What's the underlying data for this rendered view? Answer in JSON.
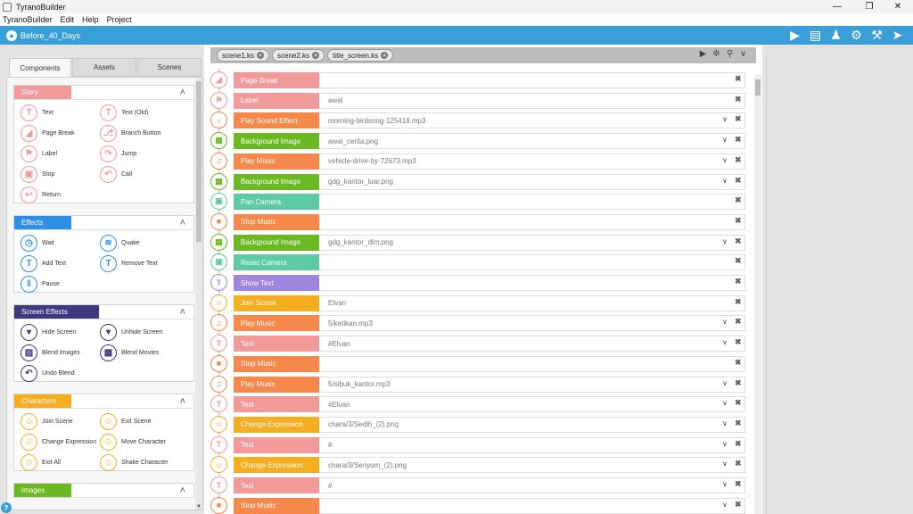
{
  "window": {
    "title": "TyranoBuilder"
  },
  "menu": [
    "TyranoBuilder",
    "Edit",
    "Help",
    "Project"
  ],
  "project": {
    "name": "Before_40_Days"
  },
  "left_tabs": [
    "Components",
    "Assets",
    "Scenes"
  ],
  "sections": [
    {
      "title": "Story",
      "color": "#f2999a",
      "items": [
        "Text",
        "Text (Old)",
        "Page Break",
        "Branch Button",
        "Label",
        "Jump",
        "Stop",
        "Call",
        "Return"
      ]
    },
    {
      "title": "Effects",
      "color": "#2f8fe6",
      "items": [
        "Wait",
        "Quake",
        "Add Text",
        "Remove Text",
        "Pause"
      ]
    },
    {
      "title": "Screen Effects",
      "color": "#3e3880",
      "items": [
        "Hide Screen",
        "Unhide Screen",
        "Blend Images",
        "Blend Movies",
        "Undo Blend"
      ]
    },
    {
      "title": "Characters",
      "color": "#f5ae1f",
      "items": [
        "Join Scene",
        "Exit Scene",
        "Change Expression",
        "Move Character",
        "Exit All",
        "Shake Character"
      ]
    },
    {
      "title": "Images",
      "color": "#6ab822",
      "items": []
    }
  ],
  "file_tabs": [
    "scene1.ks",
    "scene2.ks",
    "title_screen.ks"
  ],
  "script_rows": [
    {
      "label": "Page Break",
      "value": "",
      "color": "#f2999a",
      "icon": "page-break",
      "dropdown": false
    },
    {
      "label": "Label",
      "value": "awal",
      "color": "#f2999a",
      "icon": "label",
      "dropdown": false
    },
    {
      "label": "Play Sound Effect",
      "value": "morning-birdsong-125418.mp3",
      "color": "#f5884a",
      "icon": "sound",
      "dropdown": true
    },
    {
      "label": "Background Image",
      "value": "awal_cerita.png",
      "color": "#6ab822",
      "icon": "background",
      "dropdown": true
    },
    {
      "label": "Play Music",
      "value": "vehicle-drive-by-72673.mp3",
      "color": "#f5884a",
      "icon": "music",
      "dropdown": true
    },
    {
      "label": "Background Image",
      "value": "gdg_kantor_luar.png",
      "color": "#6ab822",
      "icon": "background",
      "dropdown": true
    },
    {
      "label": "Pan Camera",
      "value": "",
      "color": "#5ccaa5",
      "icon": "camera",
      "dropdown": false
    },
    {
      "label": "Stop Music",
      "value": "",
      "color": "#f5884a",
      "icon": "stop-music",
      "dropdown": false
    },
    {
      "label": "Background Image",
      "value": "gdg_kantor_dlm.png",
      "color": "#6ab822",
      "icon": "background",
      "dropdown": true
    },
    {
      "label": "Reset Camera",
      "value": "",
      "color": "#5ccaa5",
      "icon": "camera",
      "dropdown": false
    },
    {
      "label": "Show Text",
      "value": "",
      "color": "#9f85de",
      "icon": "show-text",
      "dropdown": false
    },
    {
      "label": "Join Scene",
      "value": "Elvan",
      "color": "#f5ae1f",
      "icon": "character",
      "dropdown": false
    },
    {
      "label": "Play Music",
      "value": "5/ketikan.mp3",
      "color": "#f5884a",
      "icon": "music",
      "dropdown": true
    },
    {
      "label": "Text",
      "value": "#Elvan",
      "color": "#f2999a",
      "icon": "text",
      "dropdown": true
    },
    {
      "label": "Stop Music",
      "value": "",
      "color": "#f5884a",
      "icon": "stop-music",
      "dropdown": false
    },
    {
      "label": "Play Music",
      "value": "5/sibuk_kantor.mp3",
      "color": "#f5884a",
      "icon": "music",
      "dropdown": true
    },
    {
      "label": "Text",
      "value": "#Elvan",
      "color": "#f2999a",
      "icon": "text",
      "dropdown": true
    },
    {
      "label": "Change Expression",
      "value": "chara/3/Sedih_(2).png",
      "color": "#f5ae1f",
      "icon": "character",
      "dropdown": true
    },
    {
      "label": "Text",
      "value": "#",
      "color": "#f2999a",
      "icon": "text",
      "dropdown": true
    },
    {
      "label": "Change Expression",
      "value": "chara/3/Senyum_(2).png",
      "color": "#f5ae1f",
      "icon": "character",
      "dropdown": true
    },
    {
      "label": "Text",
      "value": "#",
      "color": "#f2999a",
      "icon": "text",
      "dropdown": true
    },
    {
      "label": "Stop Music",
      "value": "",
      "color": "#f5884a",
      "icon": "stop-music",
      "dropdown": true
    }
  ]
}
